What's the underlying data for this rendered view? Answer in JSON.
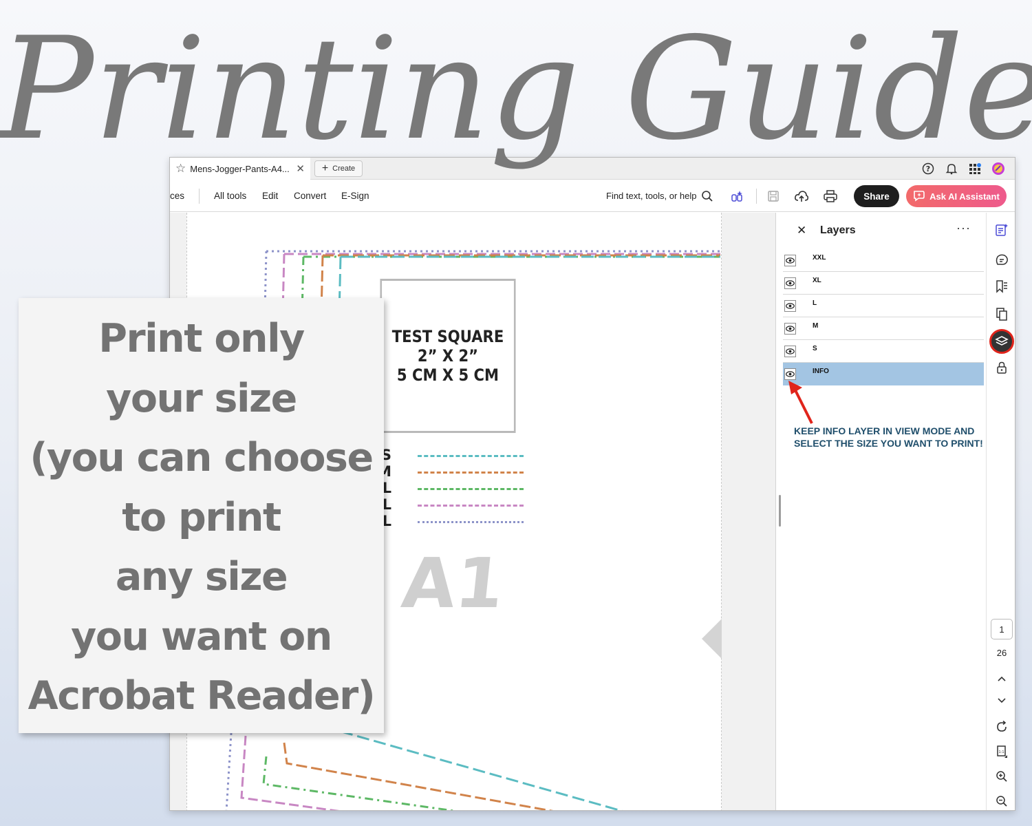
{
  "headline": "Printing Guide",
  "window": {
    "tab_title": "Mens-Jogger-Pants-A4...",
    "create_label": "Create",
    "menu": {
      "truncated_item": "ces",
      "items": [
        "All tools",
        "Edit",
        "Convert",
        "E-Sign"
      ]
    },
    "search_placeholder": "Find text, tools, or help",
    "share_label": "Share",
    "ai_label": "Ask AI Assistant"
  },
  "document": {
    "test_square": [
      "TEST SQUARE",
      "2” X 2”",
      "5 CM X 5 CM"
    ],
    "legend": [
      {
        "label": "S",
        "color": "#5bbcc2"
      },
      {
        "label": "M",
        "color": "#d1834a"
      },
      {
        "label": "L",
        "color": "#5db865"
      },
      {
        "label": "XL",
        "color": "#c887c3"
      },
      {
        "label": "XXL",
        "color": "#8d93c9"
      }
    ],
    "watermark": "A1"
  },
  "layers_panel": {
    "title": "Layers",
    "layers": [
      "XXL",
      "XL",
      "L",
      "M",
      "S",
      "INFO"
    ],
    "selected_layer": "INFO",
    "note": "KEEP INFO LAYER IN VIEW MODE AND SELECT THE SIZE YOU WANT TO PRINT!"
  },
  "pager": {
    "current_page": "1",
    "total_pages": "26"
  },
  "card_lines": [
    "Print only",
    "your size",
    "(you can choose",
    "to print",
    "any size",
    "you want on",
    "Acrobat Reader)"
  ],
  "colors": {
    "accent_red": "#e0241b",
    "ai_gradient_start": "#f26a6a",
    "selected_layer": "#a3c5e3",
    "note_text": "#1f4e6b"
  }
}
